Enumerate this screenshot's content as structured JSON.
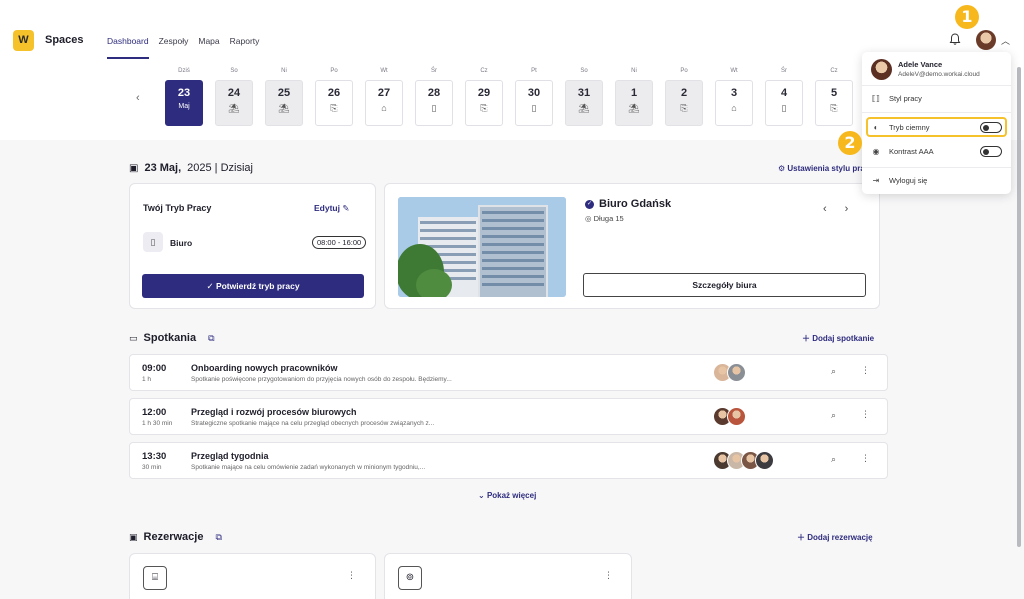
{
  "app": {
    "logo_letter": "W",
    "title": "Spaces"
  },
  "nav": [
    {
      "label": "Dashboard",
      "active": true
    },
    {
      "label": "Zespoły",
      "active": false
    },
    {
      "label": "Mapa",
      "active": false
    },
    {
      "label": "Raporty",
      "active": false
    }
  ],
  "days": [
    {
      "dow": "Dziś",
      "num": "23",
      "sub": "Maj",
      "type": "selected"
    },
    {
      "dow": "So",
      "num": "24",
      "sub": "⛱",
      "type": "weekend"
    },
    {
      "dow": "Ni",
      "num": "25",
      "sub": "⛱",
      "type": "weekend"
    },
    {
      "dow": "Po",
      "num": "26",
      "sub": "⎘",
      "type": "normal"
    },
    {
      "dow": "Wt",
      "num": "27",
      "sub": "⌂",
      "type": "normal"
    },
    {
      "dow": "Śr",
      "num": "28",
      "sub": "▯",
      "type": "normal"
    },
    {
      "dow": "Cz",
      "num": "29",
      "sub": "⎘",
      "type": "normal"
    },
    {
      "dow": "Pt",
      "num": "30",
      "sub": "▯",
      "type": "normal"
    },
    {
      "dow": "So",
      "num": "31",
      "sub": "⛱",
      "type": "weekend"
    },
    {
      "dow": "Ni",
      "num": "1",
      "sub": "⛱",
      "type": "weekend"
    },
    {
      "dow": "Po",
      "num": "2",
      "sub": "⎘",
      "type": "weekend"
    },
    {
      "dow": "Wt",
      "num": "3",
      "sub": "⌂",
      "type": "normal"
    },
    {
      "dow": "Śr",
      "num": "4",
      "sub": "▯",
      "type": "normal"
    },
    {
      "dow": "Cz",
      "num": "5",
      "sub": "⎘",
      "type": "normal"
    }
  ],
  "header": {
    "date_bold": "23 Maj,",
    "date_rest": "2025 | Dzisiaj",
    "settings_link": "Ustawienia stylu pracy"
  },
  "work_mode": {
    "title": "Twój Tryb Pracy",
    "edit_label": "Edytuj",
    "office_label": "Biuro",
    "hours": "08:00 - 16:00",
    "confirm_label": "Potwierdź tryb pracy"
  },
  "office": {
    "name": "Biuro Gdańsk",
    "address": "Długa 15",
    "details_label": "Szczegóły biura"
  },
  "meetings_section": {
    "title": "Spotkania",
    "add_label": "Dodaj spotkanie"
  },
  "meetings": [
    {
      "time": "09:00",
      "duration": "1 h",
      "title": "Onboarding nowych pracowników",
      "desc": "Spotkanie poświęcone przygotowaniom do przyjęcia nowych osób do zespołu. Będziemy...",
      "avatars": [
        "#d9b59a",
        "#8a8f96"
      ]
    },
    {
      "time": "12:00",
      "duration": "1 h 30 min",
      "title": "Przegląd i rozwój procesów biurowych",
      "desc": "Strategiczne spotkanie mające na celu przegląd obecnych procesów związanych z...",
      "avatars": [
        "#5a3a2e",
        "#b8553c"
      ]
    },
    {
      "time": "13:30",
      "duration": "30 min",
      "title": "Przegląd tygodnia",
      "desc": "Spotkanie mające na celu omówienie zadań wykonanych w minionym tygodniu,...",
      "avatars": [
        "#4a3a30",
        "#c9b8a8",
        "#7a5646",
        "#3b3b40"
      ]
    }
  ],
  "show_more": "Pokaż więcej",
  "reservations_section": {
    "title": "Rezerwacje",
    "add_label": "Dodaj rezerwację"
  },
  "user_menu": {
    "name": "Adele Vance",
    "email": "AdeleV@demo.workai.cloud",
    "items": [
      {
        "label": "Styl pracy",
        "icon": "work-style-icon"
      },
      {
        "label": "Tryb ciemny",
        "icon": "dark-mode-icon",
        "toggle": false
      },
      {
        "label": "Kontrast AAA",
        "icon": "contrast-icon",
        "toggle": false
      },
      {
        "label": "Wyloguj się",
        "icon": "logout-icon"
      }
    ]
  },
  "callouts": [
    "1",
    "2"
  ],
  "colors": {
    "accent": "#2e2c7e",
    "brand_yellow": "#f6c22b",
    "callout": "#f6b81d"
  }
}
